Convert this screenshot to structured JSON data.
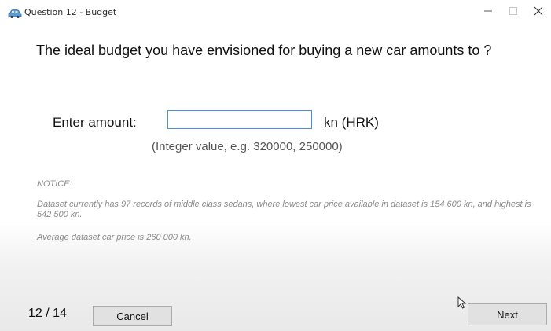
{
  "window": {
    "title": "Question 12 - Budget",
    "icon": "car-icon",
    "controls": [
      "minimize-icon",
      "maximize-icon",
      "close-icon"
    ]
  },
  "question": {
    "text": "The ideal budget you have envisioned for buying a new car amounts to ?"
  },
  "amount": {
    "label": "Enter amount:",
    "value": "",
    "placeholder": "",
    "unit": "kn (HRK)",
    "hint": "(Integer value, e.g. 320000, 250000)"
  },
  "notice": {
    "title": "NOTICE:",
    "body": "Dataset currently has 97 records of middle class sedans, where lowest car price available in dataset is 154 600 kn, and highest is 542 500 kn.",
    "average": "Average dataset car price is 260 000 kn."
  },
  "footer": {
    "page_counter": "12 / 14",
    "cancel_label": "Cancel",
    "next_label": "Next"
  },
  "colors": {
    "input_border": "#4a90d9",
    "button_bg": "#e1e1e1",
    "notice_text": "#8a8a8a"
  }
}
